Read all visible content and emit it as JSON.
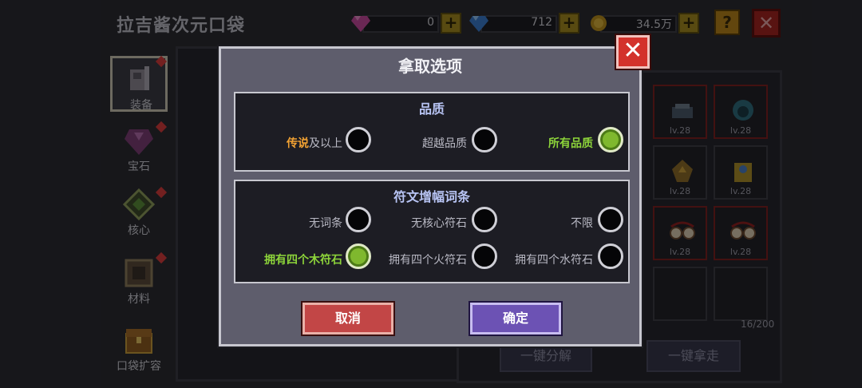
{
  "header": {
    "title": "拉吉酱次元口袋",
    "currencies": [
      {
        "icon": "pink-gem-icon",
        "value": "0"
      },
      {
        "icon": "blue-diamond-icon",
        "value": "712"
      },
      {
        "icon": "gold-coin-icon",
        "value": "34.5万"
      }
    ],
    "plus_label": "+",
    "help_label": "?",
    "close_label": "✕"
  },
  "sidebar": {
    "tabs": [
      {
        "label": "装备",
        "icon": "equipment-icon",
        "active": true
      },
      {
        "label": "宝石",
        "icon": "gem-icon"
      },
      {
        "label": "核心",
        "icon": "core-icon"
      },
      {
        "label": "材料",
        "icon": "material-icon"
      },
      {
        "label": "口袋扩容",
        "icon": "chest-icon"
      }
    ]
  },
  "inventory": {
    "slots": [
      {
        "lv": "lv.28",
        "icon": "helmet-icon"
      },
      {
        "lv": "lv.28",
        "icon": "hood-icon"
      },
      {
        "lv": "lv.28",
        "icon": "spiked-armor-icon"
      },
      {
        "lv": "lv.28",
        "icon": "gold-armor-icon"
      },
      {
        "lv": "lv.28",
        "icon": "goggles-icon"
      },
      {
        "lv": "lv.28",
        "icon": "goggles-icon"
      }
    ],
    "capacity": "16/200",
    "decompose_label": "一键分解",
    "take_all_label": "一键拿走"
  },
  "modal": {
    "title": "拿取选项",
    "close_label": "✕",
    "quality": {
      "title": "品质",
      "options": [
        {
          "label_highlight": "传说",
          "label_rest": "及以上",
          "selected": false
        },
        {
          "label": "超越品质",
          "selected": false
        },
        {
          "label": "所有品质",
          "selected": true
        }
      ]
    },
    "rune": {
      "title": "符文增幅词条",
      "options": [
        {
          "label": "无词条",
          "selected": false
        },
        {
          "label": "无核心符石",
          "selected": false
        },
        {
          "label": "不限",
          "selected": false
        },
        {
          "label": "拥有四个木符石",
          "selected": true
        },
        {
          "label": "拥有四个火符石",
          "selected": false
        },
        {
          "label": "拥有四个水符石",
          "selected": false
        }
      ]
    },
    "cancel_label": "取消",
    "confirm_label": "确定"
  },
  "colors": {
    "selected_radio": "#7fb82e",
    "legend_orange": "#f2a233",
    "selected_label_green": "#8dd43a",
    "cancel_button": "#c24646",
    "confirm_button": "#6c52b4"
  }
}
